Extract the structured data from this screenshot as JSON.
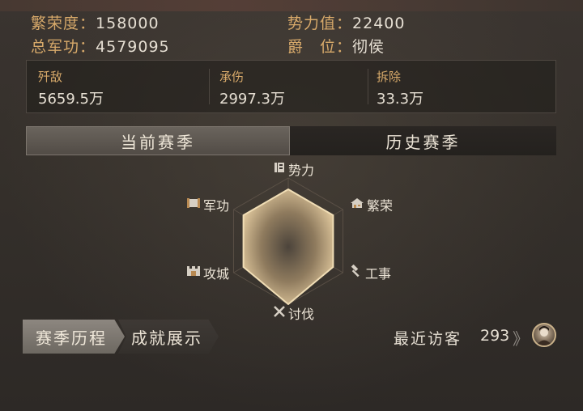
{
  "stats": {
    "prosperity": {
      "label": "繁荣度：",
      "value": "158000"
    },
    "power": {
      "label": "势力值：",
      "value": "22400"
    },
    "merit": {
      "label": "总军功：",
      "value": "4579095"
    },
    "rank": {
      "label": "爵　位：",
      "value": "彻侯"
    }
  },
  "panel": [
    {
      "label": "歼敌",
      "value": "5659.5万"
    },
    {
      "label": "承伤",
      "value": "2997.3万"
    },
    {
      "label": "拆除",
      "value": "33.3万"
    }
  ],
  "tabs": {
    "current": "当前赛季",
    "history": "历史赛季",
    "selected": "current"
  },
  "radar": {
    "axes": [
      "势力",
      "繁荣",
      "工事",
      "讨伐",
      "攻城",
      "军功"
    ],
    "values": [
      0.82,
      0.82,
      0.82,
      1.0,
      0.82,
      0.82
    ],
    "colors": {
      "fill": "#d9c196",
      "stroke": "#f0ddb5",
      "grid": "#5a5046",
      "icon": "#d6cfc4",
      "icon_accent": "#b98a52"
    }
  },
  "bottom": {
    "season_history": "赛季历程",
    "achievements": "成就展示",
    "recent_visitors_label": "最近访客",
    "recent_visitors_count": "293",
    "chevron": "》"
  },
  "colors": {
    "label_gold": "#d7a96a",
    "text": "#e6dfd3"
  }
}
